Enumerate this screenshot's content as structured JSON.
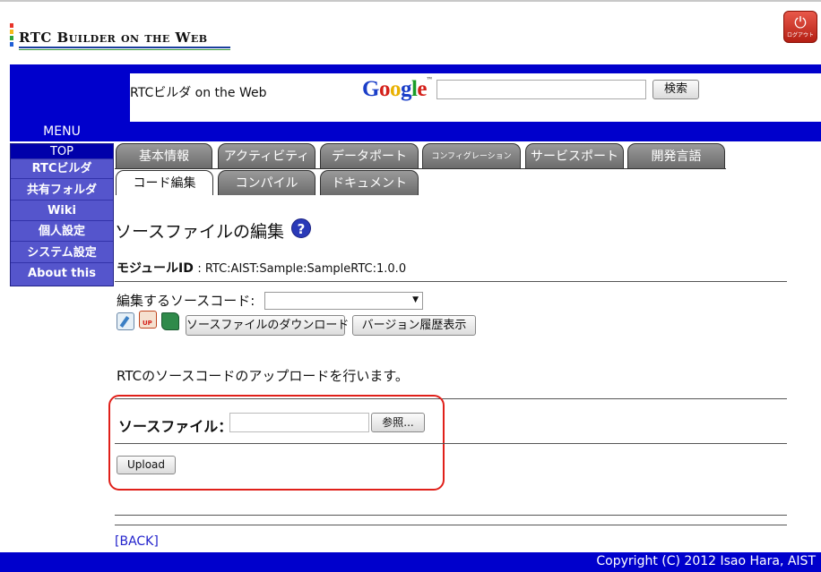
{
  "logo": {
    "text": "RTC Builder on the Web",
    "bar_colors": [
      "#e8342a",
      "#f3b81a",
      "#2fa43a",
      "#1f5fd6"
    ]
  },
  "logout": {
    "label": "ログアウト"
  },
  "header": {
    "site_title": "RTCビルダ on the Web",
    "google_parts": [
      "G",
      "o",
      "o",
      "g",
      "l",
      "e"
    ],
    "search_button": "検索"
  },
  "sidebar": {
    "menu_label": "MENU",
    "items": [
      "TOP",
      "RTCビルダ",
      "共有フォルダ",
      "Wiki",
      "個人設定",
      "システム設定",
      "About this"
    ]
  },
  "tabs": {
    "row1": [
      "基本情報",
      "アクティビティ",
      "データポート",
      "コンフィグレーション",
      "サービスポート",
      "開発言語"
    ],
    "row2": [
      "コード編集",
      "コンパイル",
      "ドキュメント"
    ],
    "active": "コード編集"
  },
  "main": {
    "title": "ソースファイルの編集",
    "module_key": "モジュールID",
    "module_value": ": RTC:AIST:Sample:SampleRTC:1.0.0",
    "source_label": "編集するソースコード:",
    "download_button": "ソースファイルのダウンロード",
    "history_button": "バージョン履歴表示",
    "upload_description": "RTCのソースコードのアップロードを行います。",
    "file_label": "ソースファイル：",
    "browse_button": "参照...",
    "upload_button": "Upload",
    "back_link": "[BACK]"
  },
  "footer": {
    "copyright": "Copyright (C) 2012 Isao Hara, AIST"
  },
  "colors": {
    "nav_blue": "#0000cc",
    "highlight_red": "#e0201a"
  }
}
